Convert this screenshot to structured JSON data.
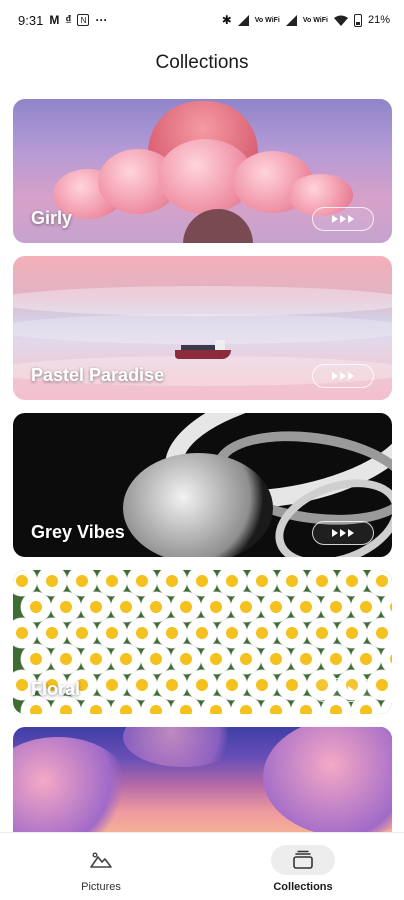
{
  "status_bar": {
    "time": "9:31",
    "notif_1": "M",
    "notif_2": "₫",
    "notif_3": "N",
    "more": "···",
    "bluetooth": "✱",
    "network_1": "Vo WiFi",
    "network_2": "Vo WiFi",
    "battery": "21%"
  },
  "header": {
    "title": "Collections"
  },
  "collections": [
    {
      "title": "Girly"
    },
    {
      "title": "Pastel Paradise"
    },
    {
      "title": "Grey Vibes"
    },
    {
      "title": "Floral"
    },
    {
      "title": ""
    }
  ],
  "bottom_nav": {
    "items": [
      {
        "label": "Pictures",
        "icon": "mountain-image-icon",
        "active": false
      },
      {
        "label": "Collections",
        "icon": "stack-icon",
        "active": true
      }
    ]
  }
}
